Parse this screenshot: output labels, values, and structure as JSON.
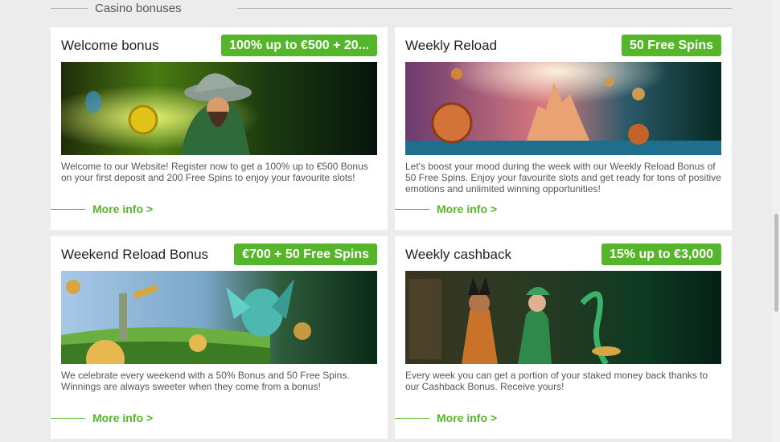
{
  "section": {
    "title": "Casino bonuses"
  },
  "cards": [
    {
      "title": "Welcome bonus",
      "badge": "100% up to €500 + 20...",
      "description": "Welcome to our Website! Register now to get a 100% up to €500 Bonus on your first deposit and 200 Free Spins to enjoy your favourite slots!",
      "more": "More info >"
    },
    {
      "title": "Weekly Reload",
      "badge": "50 Free Spins",
      "description": "Let's boost your mood during the week with our Weekly Reload Bonus of 50 Free Spins. Enjoy your favourite slots and get ready for tons of positive emotions and unlimited winning opportunities!",
      "more": "More info >"
    },
    {
      "title": "Weekend Reload Bonus",
      "badge": "€700 + 50 Free Spins",
      "description": "We celebrate every weekend with a 50% Bonus and 50 Free Spins. Winnings are always sweeter when they come from a bonus!",
      "more": "More info >"
    },
    {
      "title": "Weekly cashback",
      "badge": "15% up to €3,000",
      "description": "Every week you can get a portion of your staked money back thanks to our Cashback Bonus. Receive yours!",
      "more": "More info >"
    }
  ],
  "colors": {
    "accent": "#55b52b",
    "background": "#ececec",
    "card": "#ffffff"
  }
}
